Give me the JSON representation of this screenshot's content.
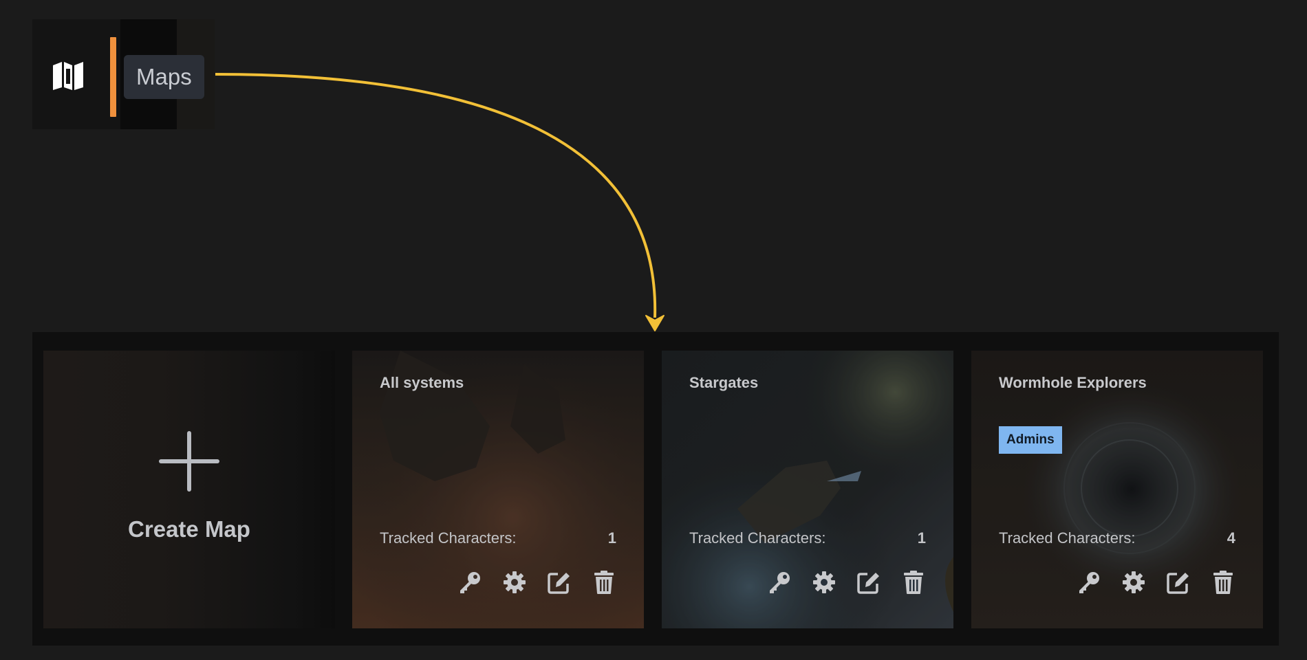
{
  "sidebar": {
    "icon": "map-icon",
    "tooltip": "Maps",
    "accent_color": "#f0913d"
  },
  "annotation": {
    "arrow_color": "#f2c037"
  },
  "create_card": {
    "label": "Create Map",
    "icon": "plus-icon"
  },
  "maps": [
    {
      "title": "All systems",
      "tag": "",
      "tracked_label": "Tracked Characters:",
      "tracked_count": "1"
    },
    {
      "title": "Stargates",
      "tag": "",
      "tracked_label": "Tracked Characters:",
      "tracked_count": "1"
    },
    {
      "title": "Wormhole Explorers",
      "tag": "Admins",
      "tag_color": "#7fb6f0",
      "tracked_label": "Tracked Characters:",
      "tracked_count": "4"
    }
  ],
  "card_actions": [
    "key-icon",
    "gear-icon",
    "edit-icon",
    "trash-icon"
  ]
}
